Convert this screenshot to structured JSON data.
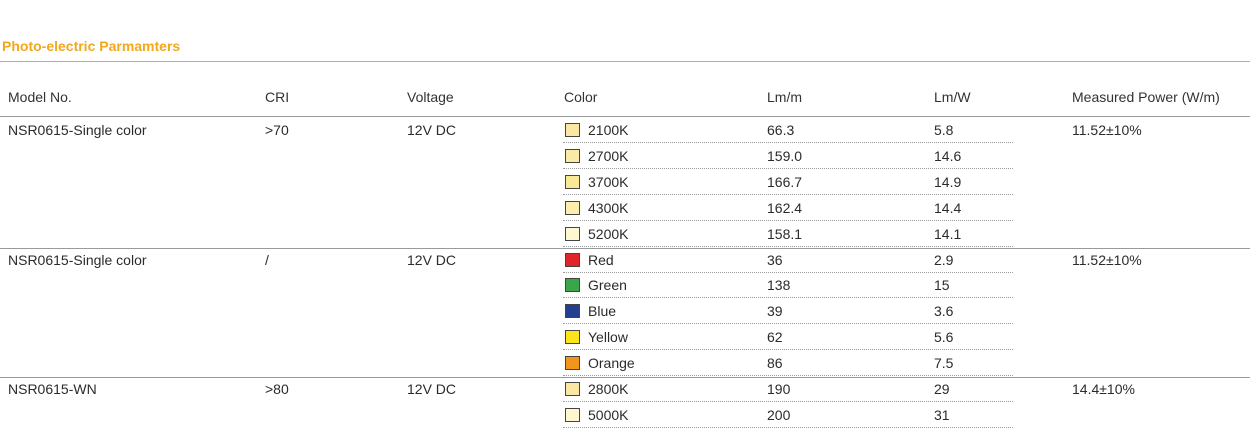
{
  "section_title": "Photo-electric Parmamters",
  "headers": {
    "model": "Model No.",
    "cri": "CRI",
    "voltage": "Voltage",
    "color": "Color",
    "lmm": "Lm/m",
    "lmw": "Lm/W",
    "power": "Measured Power (W/m)"
  },
  "groups": [
    {
      "model": "NSR0615-Single color",
      "cri": ">70",
      "voltage": "12V DC",
      "power": "11.52±10%",
      "rows": [
        {
          "color": "2100K",
          "swatch": "#f9e7a3",
          "lmm": "66.3",
          "lmw": "5.8"
        },
        {
          "color": "2700K",
          "swatch": "#faeaa5",
          "lmm": "159.0",
          "lmw": "14.6"
        },
        {
          "color": "3700K",
          "swatch": "#f8e996",
          "lmm": "166.7",
          "lmw": "14.9"
        },
        {
          "color": "4300K",
          "swatch": "#f9eeae",
          "lmm": "162.4",
          "lmw": "14.4"
        },
        {
          "color": "5200K",
          "swatch": "#fdf8d2",
          "lmm": "158.1",
          "lmw": "14.1"
        }
      ]
    },
    {
      "model": "NSR0615-Single color",
      "cri": "/",
      "voltage": "12V DC",
      "power": "11.52±10%",
      "rows": [
        {
          "color": "Red",
          "swatch": "#e0242a",
          "lmm": "36",
          "lmw": "2.9"
        },
        {
          "color": "Green",
          "swatch": "#3aa648",
          "lmm": "138",
          "lmw": "15"
        },
        {
          "color": "Blue",
          "swatch": "#233e8f",
          "lmm": "39",
          "lmw": "3.6"
        },
        {
          "color": "Yellow",
          "swatch": "#fbe41a",
          "lmm": "62",
          "lmw": "5.6"
        },
        {
          "color": "Orange",
          "swatch": "#f3941c",
          "lmm": "86",
          "lmw": "7.5"
        }
      ]
    },
    {
      "model": "NSR0615-WN",
      "cri": ">80",
      "voltage": "12V DC",
      "power": "14.4±10%",
      "rows": [
        {
          "color": "2800K",
          "swatch": "#f9e7a3",
          "lmm": "190",
          "lmw": "29"
        },
        {
          "color": "5000K",
          "swatch": "#fdf6d0",
          "lmm": "200",
          "lmw": "31"
        }
      ]
    }
  ]
}
